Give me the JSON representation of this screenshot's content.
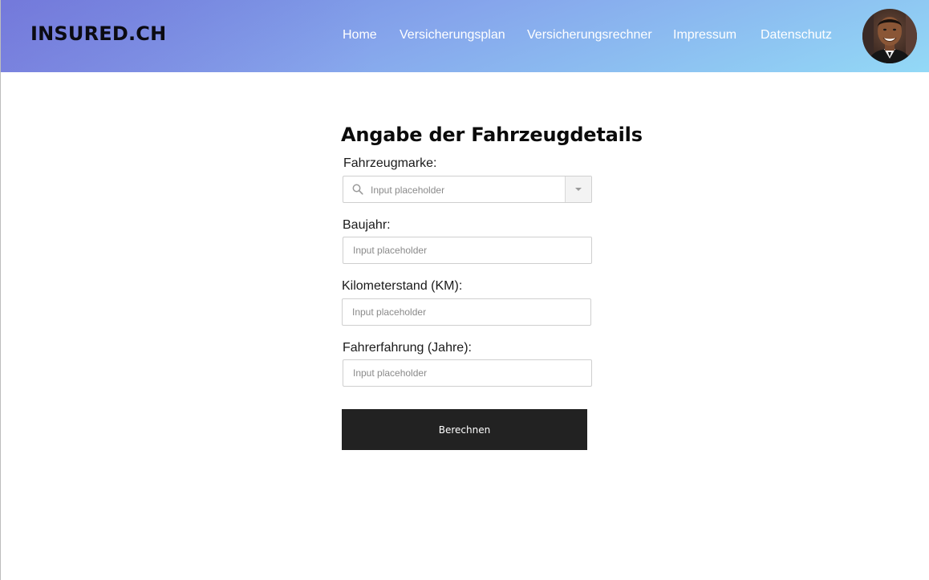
{
  "header": {
    "logo": "INSURED.CH",
    "nav": [
      {
        "label": "Home"
      },
      {
        "label": "Versicherungsplan"
      },
      {
        "label": "Versicherungsrechner"
      },
      {
        "label": "Impressum"
      },
      {
        "label": "Datenschutz"
      }
    ],
    "avatar_icon": "user-avatar"
  },
  "form": {
    "title": "Angabe der Fahrzeugdetails",
    "fields": {
      "marke": {
        "label": "Fahrzeugmarke:",
        "placeholder": "Input placeholder",
        "value": "",
        "icon": "search-icon"
      },
      "baujahr": {
        "label": "Baujahr:",
        "placeholder": "Input placeholder",
        "value": ""
      },
      "km": {
        "label": "Kilometerstand (KM):",
        "placeholder": "Input placeholder",
        "value": ""
      },
      "erfahrung": {
        "label": "Fahrerfahrung (Jahre):",
        "placeholder": "Input placeholder",
        "value": ""
      }
    },
    "submit_label": "Berechnen"
  },
  "colors": {
    "header_gradient_start": "#6f82dd",
    "header_gradient_end": "#93d9f6",
    "button_bg": "#222222",
    "nav_text": "#ffffff"
  }
}
